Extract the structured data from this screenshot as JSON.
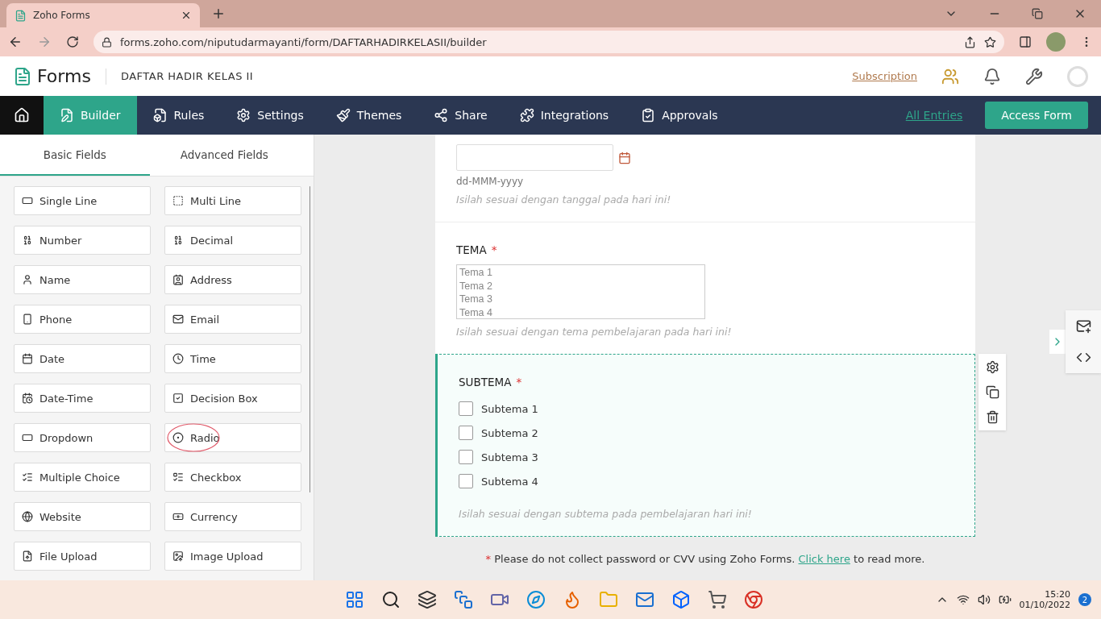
{
  "browser": {
    "tab_title": "Zoho Forms",
    "url": "forms.zoho.com/niputudarmayanti/form/DAFTARHADIRKELASII/builder"
  },
  "header": {
    "app_name": "Forms",
    "form_title": "DAFTAR HADIR KELAS II",
    "subscription_link": "Subscription"
  },
  "nav": {
    "items": [
      {
        "kind": "builder",
        "label": "Builder",
        "selected": true
      },
      {
        "kind": "rules",
        "label": "Rules",
        "selected": false
      },
      {
        "kind": "settings",
        "label": "Settings",
        "selected": false
      },
      {
        "kind": "themes",
        "label": "Themes",
        "selected": false
      },
      {
        "kind": "share",
        "label": "Share",
        "selected": false
      },
      {
        "kind": "integrations",
        "label": "Integrations",
        "selected": false
      },
      {
        "kind": "approvals",
        "label": "Approvals",
        "selected": false
      }
    ],
    "all_entries_link": "All Entries",
    "access_form_button": "Access Form"
  },
  "sidebar": {
    "tabs": [
      {
        "label": "Basic Fields",
        "selected": true
      },
      {
        "label": "Advanced Fields",
        "selected": false
      }
    ],
    "fields": [
      {
        "kind": "single_line",
        "label": "Single Line",
        "circled": false
      },
      {
        "kind": "multi_line",
        "label": "Multi Line",
        "circled": false
      },
      {
        "kind": "number",
        "label": "Number",
        "circled": false
      },
      {
        "kind": "decimal",
        "label": "Decimal",
        "circled": false
      },
      {
        "kind": "name",
        "label": "Name",
        "circled": false
      },
      {
        "kind": "address",
        "label": "Address",
        "circled": false
      },
      {
        "kind": "phone",
        "label": "Phone",
        "circled": false
      },
      {
        "kind": "email",
        "label": "Email",
        "circled": false
      },
      {
        "kind": "date",
        "label": "Date",
        "circled": false
      },
      {
        "kind": "time",
        "label": "Time",
        "circled": false
      },
      {
        "kind": "datetime",
        "label": "Date-Time",
        "circled": false
      },
      {
        "kind": "decision",
        "label": "Decision Box",
        "circled": false
      },
      {
        "kind": "dropdown",
        "label": "Dropdown",
        "circled": false
      },
      {
        "kind": "radio",
        "label": "Radio",
        "circled": true
      },
      {
        "kind": "multiple_choice",
        "label": "Multiple Choice",
        "circled": false
      },
      {
        "kind": "checkbox",
        "label": "Checkbox",
        "circled": false
      },
      {
        "kind": "website",
        "label": "Website",
        "circled": false
      },
      {
        "kind": "currency",
        "label": "Currency",
        "circled": false
      },
      {
        "kind": "file_upload",
        "label": "File Upload",
        "circled": false
      },
      {
        "kind": "image_upload",
        "label": "Image Upload",
        "circled": false
      }
    ]
  },
  "form": {
    "sections": [
      {
        "kind": "date",
        "selected": false,
        "format_hint": "dd-MMM-yyyy",
        "help": "Isilah sesuai dengan tanggal pada hari ini!"
      },
      {
        "kind": "listbox",
        "selected": false,
        "label": "TEMA",
        "required": true,
        "options": [
          "Tema 1",
          "Tema 2",
          "Tema 3",
          "Tema 4"
        ],
        "help": "Isilah sesuai dengan tema pembelajaran pada hari ini!"
      },
      {
        "kind": "checkboxes",
        "selected": true,
        "label": "SUBTEMA",
        "required": true,
        "options": [
          {
            "label": "Subtema 1",
            "checked": false
          },
          {
            "label": "Subtema 2",
            "checked": false
          },
          {
            "label": "Subtema 3",
            "checked": false
          },
          {
            "label": "Subtema 4",
            "checked": false
          }
        ],
        "help": "Isilah sesuai dengan subtema pada pembelajaran hari ini!"
      }
    ],
    "notice": {
      "mark": "*",
      "text": "Please do not collect password or CVV using Zoho Forms.",
      "link": "Click here",
      "suffix": "to read more."
    }
  },
  "taskbar": {
    "time": "15:20",
    "date": "01/10/2022",
    "badge": "2"
  }
}
